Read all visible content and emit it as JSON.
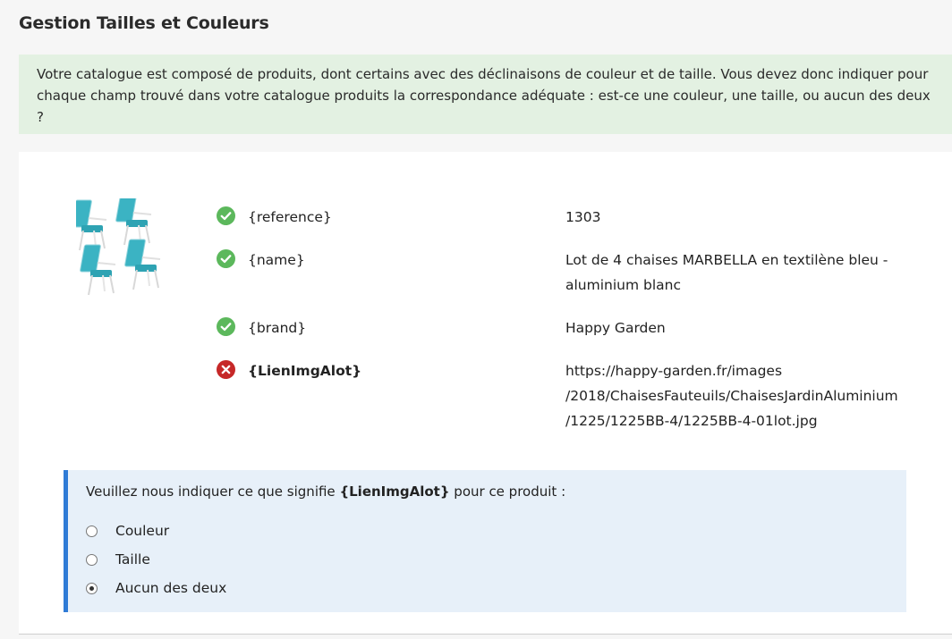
{
  "page": {
    "title": "Gestion Tailles et Couleurs"
  },
  "banner": {
    "text": "Votre catalogue est composé de produits, dont certains avec des déclinaisons de couleur et de taille. Vous devez donc indiquer pour chaque champ trouvé dans votre catalogue produits la correspondance adéquate : est-ce une couleur, une taille, ou aucun des deux ?"
  },
  "product": {
    "image_icon": "chairs-image",
    "fields": [
      {
        "key": "{reference}",
        "value": "1303",
        "status": "valid",
        "status_icon": "check-circle-icon"
      },
      {
        "key": "{name}",
        "value": "Lot de 4 chaises MARBELLA en textilène bleu - aluminium blanc",
        "status": "valid",
        "status_icon": "check-circle-icon"
      },
      {
        "key": "{brand}",
        "value": "Happy Garden",
        "status": "valid",
        "status_icon": "check-circle-icon"
      },
      {
        "key": "{LienImgAlot}",
        "value": "https://happy-garden.fr/images /2018/ChaisesFauteuils/ChaisesJardinAluminium /1225/1225BB-4/1225BB-4-01lot.jpg",
        "status": "invalid",
        "status_icon": "error-circle-icon"
      }
    ]
  },
  "question": {
    "prefix": "Veuillez nous indiquer ce que signifie ",
    "field": "{LienImgAlot}",
    "suffix": " pour ce produit :",
    "options": [
      {
        "label": "Couleur",
        "selected": false
      },
      {
        "label": "Taille",
        "selected": false
      },
      {
        "label": "Aucun des deux",
        "selected": true
      }
    ]
  },
  "colors": {
    "valid": "#5cb85c",
    "invalid": "#c62828",
    "accent": "#2f7bd6",
    "banner_bg": "#e3f1e2",
    "question_bg": "#e7f0f9"
  }
}
